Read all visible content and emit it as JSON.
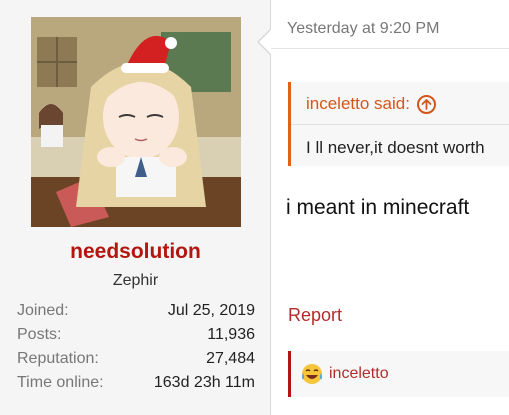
{
  "author": {
    "username": "needsolution",
    "title": "Zephir",
    "stats": [
      {
        "label": "Joined:",
        "value": "Jul 25, 2019"
      },
      {
        "label": "Posts:",
        "value": "11,936"
      },
      {
        "label": "Reputation:",
        "value": "27,484"
      },
      {
        "label": "Time online:",
        "value": "163d 23h 11m"
      }
    ]
  },
  "post": {
    "timestamp": "Yesterday at 9:20 PM",
    "quote": {
      "attribution": "inceletto said:",
      "icon": "arrow-up-circle-icon",
      "body": "I ll never,it doesnt worth"
    },
    "message": "i meant in minecraft",
    "report_label": "Report",
    "reaction": {
      "emoji": "crying-laughing-emoji",
      "user": "inceletto"
    }
  },
  "colors": {
    "username": "#b5150f",
    "quote_accent": "#e0621a",
    "link": "#b32c2c"
  }
}
